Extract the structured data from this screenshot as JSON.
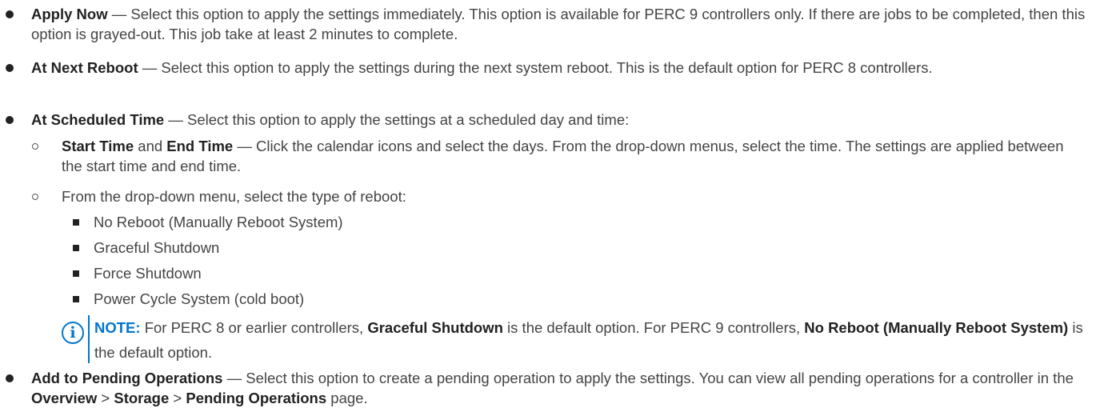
{
  "items": {
    "apply_now": {
      "label": "Apply Now",
      "text": " — Select this option to apply the settings immediately. This option is available for PERC 9 controllers only. If there are jobs to be completed, then this option is grayed-out. This job take at least 2 minutes to complete."
    },
    "next_reboot": {
      "label": "At Next Reboot",
      "text": " — Select this option to apply the settings during the next system reboot. This is the default option for PERC 8 controllers."
    },
    "scheduled": {
      "label": "At Scheduled Time",
      "text": " — Select this option to apply the settings at a scheduled day and time:",
      "start_label": "Start Time",
      "and": " and ",
      "end_label": "End Time",
      "start_text": " — Click the calendar icons and select the days. From the drop-down menus, select the time. The settings are applied between the start time and end time.",
      "reboot_text": "From the drop-down menu, select the type of reboot:",
      "reboot_options": [
        "No Reboot (Manually Reboot System)",
        "Graceful Shutdown",
        "Force Shutdown",
        "Power Cycle System (cold boot)"
      ]
    },
    "note": {
      "icon": "info-icon",
      "label": "NOTE:",
      "t1": " For PERC 8 or earlier controllers, ",
      "b1": "Graceful Shutdown",
      "t2": " is the default option. For PERC 9 controllers, ",
      "b2": "No Reboot (Manually Reboot System)",
      "t3": " is the default option."
    },
    "pending": {
      "label": "Add to Pending Operations",
      "text": " — Select this option to create a pending operation to apply the settings. You can view all pending operations for a controller in the ",
      "p1": "Overview",
      "sep1": " > ",
      "p2": "Storage",
      "sep2": " > ",
      "p3": "Pending Operations",
      "end": " page."
    }
  },
  "colors": {
    "accent": "#0076ce",
    "text": "#444444",
    "bold": "#222222"
  }
}
